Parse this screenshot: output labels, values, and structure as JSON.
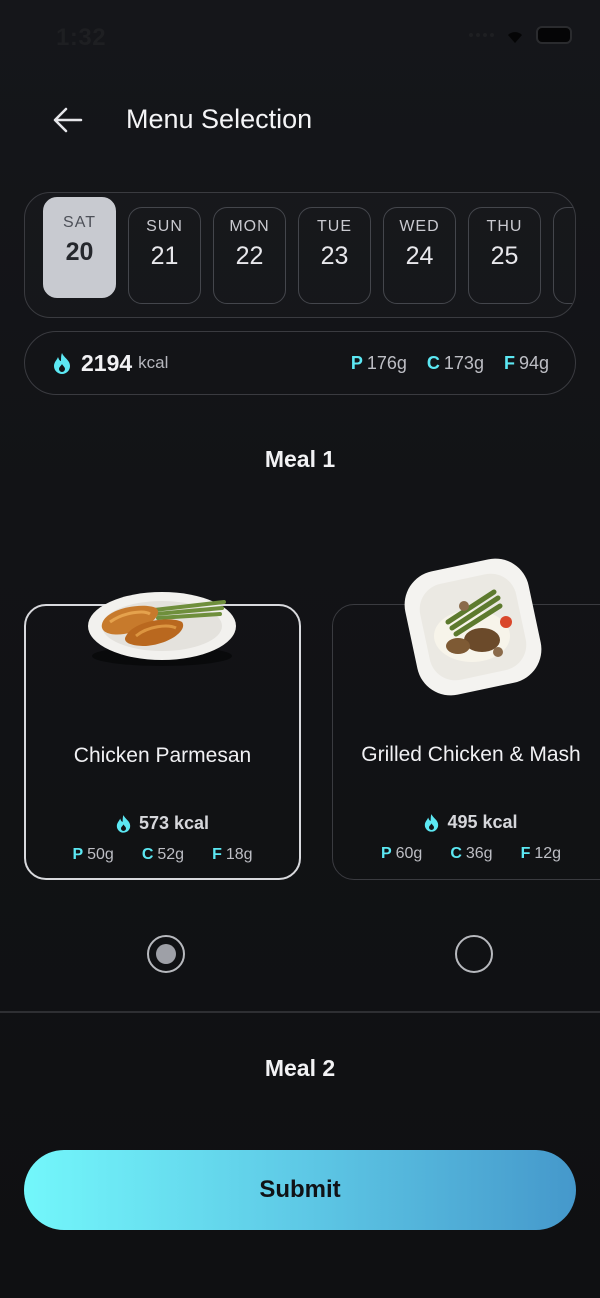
{
  "status_bar": {
    "time": "1:32"
  },
  "header": {
    "title": "Menu Selection"
  },
  "dates": [
    {
      "dow": "SAT",
      "day": "20"
    },
    {
      "dow": "SUN",
      "day": "21"
    },
    {
      "dow": "MON",
      "day": "22"
    },
    {
      "dow": "TUE",
      "day": "23"
    },
    {
      "dow": "WED",
      "day": "24"
    },
    {
      "dow": "THU",
      "day": "25"
    }
  ],
  "selected_date": "20",
  "daily_totals": {
    "kcal": "2194",
    "kcal_unit": "kcal",
    "protein_label": "P",
    "protein": "176g",
    "carbs_label": "C",
    "carbs": "173g",
    "fat_label": "F",
    "fat": "94g"
  },
  "meal1": {
    "title": "Meal 1",
    "options": [
      {
        "name": "Chicken Parmesan",
        "kcal": "573 kcal",
        "p_label": "P",
        "p": "50g",
        "c_label": "C",
        "c": "52g",
        "f_label": "F",
        "f": "18g",
        "selected": true
      },
      {
        "name": "Grilled Chicken & Mash",
        "kcal": "495 kcal",
        "p_label": "P",
        "p": "60g",
        "c_label": "C",
        "c": "36g",
        "f_label": "F",
        "f": "12g",
        "selected": false
      }
    ]
  },
  "meal2": {
    "title": "Meal 2"
  },
  "submit_label": "Submit",
  "colors": {
    "accent": "#5ce8f3",
    "background": "#131417",
    "gradient_start": "#73f7fb",
    "gradient_end": "#4598cb"
  }
}
